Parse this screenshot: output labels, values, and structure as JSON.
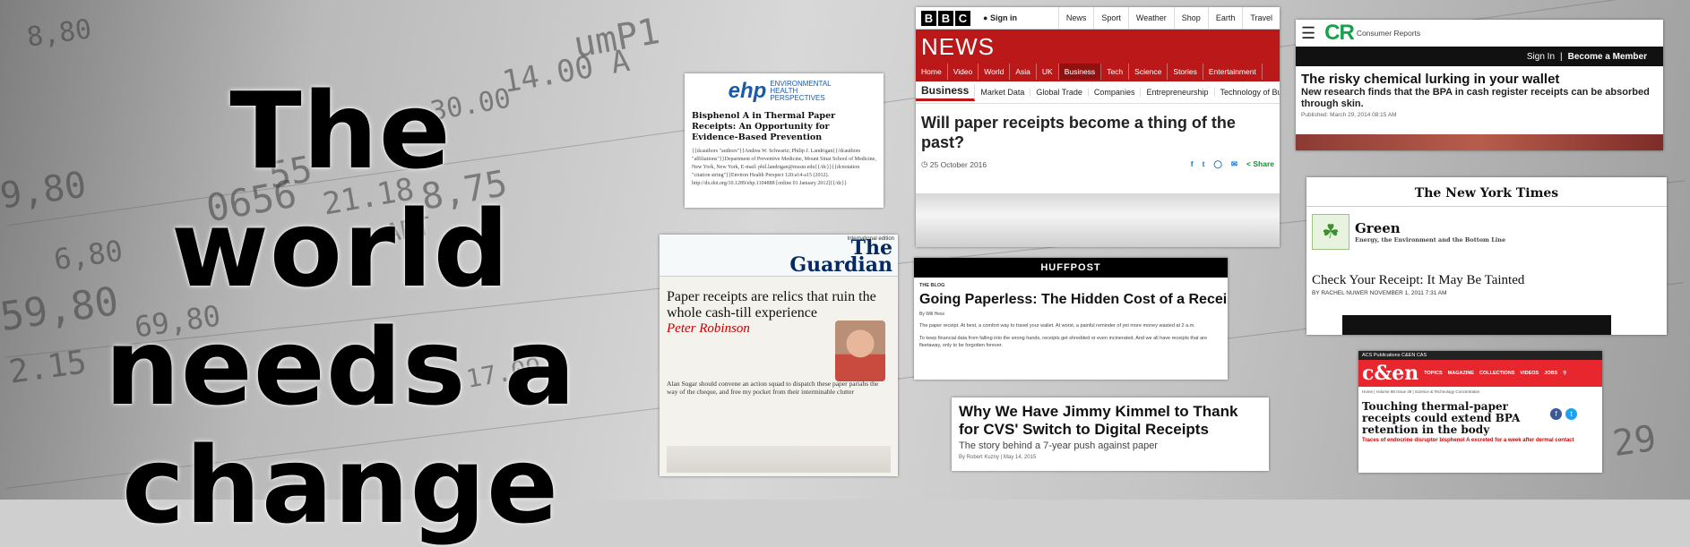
{
  "headline": {
    "line1": "The world",
    "line2": "needs a",
    "line3": "change"
  },
  "background_numbers": [
    "umP1",
    "14.00 A",
    "30.00",
    "21.18",
    "55",
    "8,75",
    "9,80",
    "59,80",
    "69,80",
    "2.15",
    "6,80",
    "8,80",
    "29",
    "ART",
    "0656",
    "17.09"
  ],
  "ehp": {
    "logo_abbr": "ehp",
    "logo_full": "ENVIRONMENTAL HEALTH PERSPECTIVES",
    "title": "Bisphenol A in Thermal Paper Receipts: An Opportunity for Evidence-Based Prevention",
    "body": "{{dcauthors \"authors\"}}Andrea W. Schwartz; Philip J. Landrigan{{/dcauthors \"affiliations\"}}Department of Preventive Medicine, Mount Sinai School of Medicine, New York, New York, E-mail: phil.landrigan@mssm.edu{{/dc}}{{dcnotation \"citation string\"}}Environ Health Perspect 120:a14-a15 (2012). http://dx.doi.org/10.1289/ehp.1104888 [online 01 January 2012]{{/dc}}"
  },
  "bbc": {
    "blocks": [
      "B",
      "B",
      "C"
    ],
    "sign_in": "Sign in",
    "top_nav": [
      "News",
      "Sport",
      "Weather",
      "Shop",
      "Earth",
      "Travel"
    ],
    "brand": "NEWS",
    "nav": [
      "Home",
      "Video",
      "World",
      "Asia",
      "UK",
      "Business",
      "Tech",
      "Science",
      "Stories",
      "Entertainment"
    ],
    "sub_nav": [
      "Business",
      "Market Data",
      "Global Trade",
      "Companies",
      "Entrepreneurship",
      "Technology of Bu"
    ],
    "headline": "Will paper receipts become a thing of the past?",
    "date": "25 October 2016",
    "share": "Share"
  },
  "cr": {
    "logo": "CR",
    "logo_text": "Consumer Reports",
    "sign_in": "Sign In",
    "sep": "|",
    "member": "Become a Member",
    "headline": "The risky chemical lurking in your wallet",
    "dek": "New research finds that the BPA in cash register receipts can be absorbed through skin.",
    "published": "Published: March 29, 2014 08:15 AM"
  },
  "nyt": {
    "masthead": "The New York Times",
    "section": "Green",
    "section_sub": "Energy, the Environment and the Bottom Line",
    "headline": "Check Your Receipt: It May Be Tainted",
    "byline": "BY RACHEL NUWER   NOVEMBER 1, 2011 7:31 AM"
  },
  "guardian": {
    "edition": "International edition",
    "logo_line1": "The",
    "logo_line2": "Guardian",
    "headline": "Paper receipts are relics that ruin the whole cash-till experience",
    "author": "Peter Robinson",
    "standfirst": "Alan Sugar should convene an action squad to dispatch these paper pariahs the way of the cheque, and free my pocket from their interminable clutter"
  },
  "huffpost": {
    "brand": "HUFFPOST",
    "blog": "THE BLOG",
    "headline": "Going Paperless: The Hidden Cost of a Receipt",
    "byline": "By Will Hess",
    "para1": "The paper receipt. At best, a comfort way to travel your wallet. At worst, a painful reminder of yet more money wasted at 2 a.m.",
    "para2": "To keep financial data from falling into the wrong hands, receipts get shredded or even incinerated. And we all have receipts that are fleetaway, only to be forgotten forever."
  },
  "cvs": {
    "headline": "Why We Have Jimmy Kimmel to Thank for CVS' Switch to Digital Receipts",
    "subhead": "The story behind a 7-year push against paper",
    "byline": "By Robert Kuzny  |  May 14, 2015"
  },
  "cen": {
    "top_bar": "ACS   Publications   C&EN   CAS",
    "logo": "c&en",
    "nav": [
      "TOPICS",
      "MAGAZINE",
      "COLLECTIONS",
      "VIDEOS",
      "JOBS"
    ],
    "crumb": "Home | Volume 88 Issue 39 | Science & Technology Concentrates",
    "headline": "Touching thermal-paper receipts could extend BPA retention in the body",
    "dek": "Traces of endocrine disruptor bisphenol A excreted for a week after dermal contact"
  },
  "colors": {
    "bbc_red": "#bb1919",
    "cr_green": "#13a34a",
    "guardian_blue": "#052962",
    "guardian_red": "#c70000",
    "cen_red": "#e8262e"
  }
}
